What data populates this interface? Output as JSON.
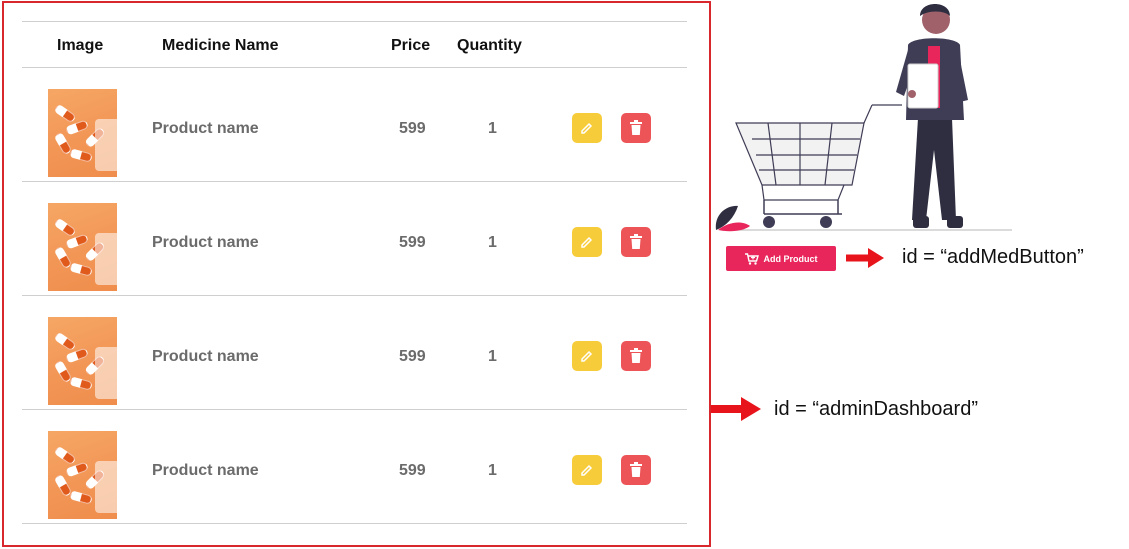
{
  "table": {
    "headers": {
      "image": "Image",
      "name": "Medicine Name",
      "price": "Price",
      "quantity": "Quantity"
    },
    "rows": [
      {
        "name": "Product name",
        "price": "599",
        "quantity": "1"
      },
      {
        "name": "Product name",
        "price": "599",
        "quantity": "1"
      },
      {
        "name": "Product name",
        "price": "599",
        "quantity": "1"
      },
      {
        "name": "Product name",
        "price": "599",
        "quantity": "1"
      }
    ]
  },
  "add_button": {
    "label": "Add Product",
    "icon": "cart-plus-icon"
  },
  "annotations": {
    "add_button_id": "id = “addMedButton”",
    "dashboard_id": "id = “adminDashboard”"
  },
  "icons": {
    "edit": "pencil-icon",
    "delete": "trash-icon"
  },
  "colors": {
    "frame_border": "#d9272e",
    "edit_button": "#f7cc3b",
    "delete_button": "#ec5458",
    "add_button": "#e9265b",
    "arrow": "#e8141b"
  }
}
